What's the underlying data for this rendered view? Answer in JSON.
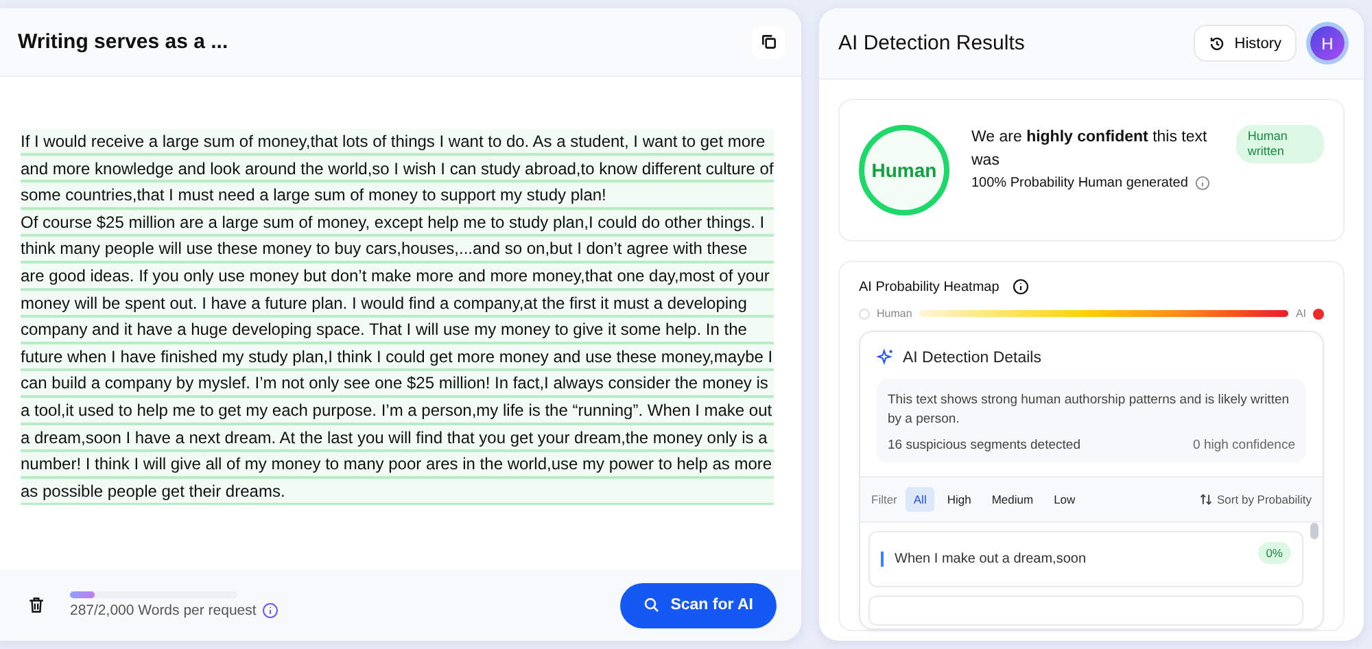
{
  "editor": {
    "title": "Writing serves as a ...",
    "paragraphs": [
      "If I would receive a large sum of money,that lots of things I want to do. As a student, I want to get more and more knowledge and look around the world,so I wish I can study abroad,to know different culture of some countries,that I must need a large sum of money to support my study plan!",
      "Of course $25 million are a large sum of money, except help me to study plan,I could do other things. I think many people will use these money to buy cars,houses,...and so on,but I don’t agree with these are good ideas. If you only use money but don’t make more and more money,that one day,most of your money will be spent out. I have a future plan. I would find a company,at the first it must a developing company and it have a huge developing space. That I will use my money to give it some help. In the future when I have finished my study plan,I think I could get more money and use these money,maybe I can build a company by myslef. I’m not only see one $25 million! In fact,I always consider the money is a tool,it used to help me to get my each purpose. I’m a person,my life is the “running”. When I make out a dream,soon I have a next dream. At the last you will find that you get your dream,the money only is a number! I think I will give all of my money to many poor ares in the world,use my power to help as more as possible people get their dreams."
    ],
    "word_count": {
      "level": 0.1435,
      "text": "287/2,000 Words per request"
    },
    "scan_button": "Scan for AI"
  },
  "results": {
    "title": "AI Detection Results",
    "history_button": "History",
    "avatar": "H",
    "verdict": {
      "label": "Human",
      "statement": "We are **highly confident** this text was",
      "probability": "100% Probability Human generated",
      "badge": "Human written"
    },
    "heatmap": {
      "title": "AI Probability Heatmap",
      "low_label": "Human",
      "high_label": "AI"
    },
    "details": {
      "title": "AI Detection Details",
      "summary": "This text shows strong human authorship patterns and is likely written by a person.",
      "segments": "16 suspicious segments detected",
      "high_confidence": "0 high confidence"
    },
    "filter": {
      "label": "Filter",
      "options": [
        {
          "label": "All",
          "selected": true
        },
        {
          "label": "High",
          "selected": false
        },
        {
          "label": "Medium",
          "selected": false
        },
        {
          "label": "Low",
          "selected": false
        }
      ],
      "sort": "Sort by Probability"
    },
    "segments": [
      {
        "text": "When I make out a dream,soon",
        "score": "0%"
      }
    ]
  }
}
